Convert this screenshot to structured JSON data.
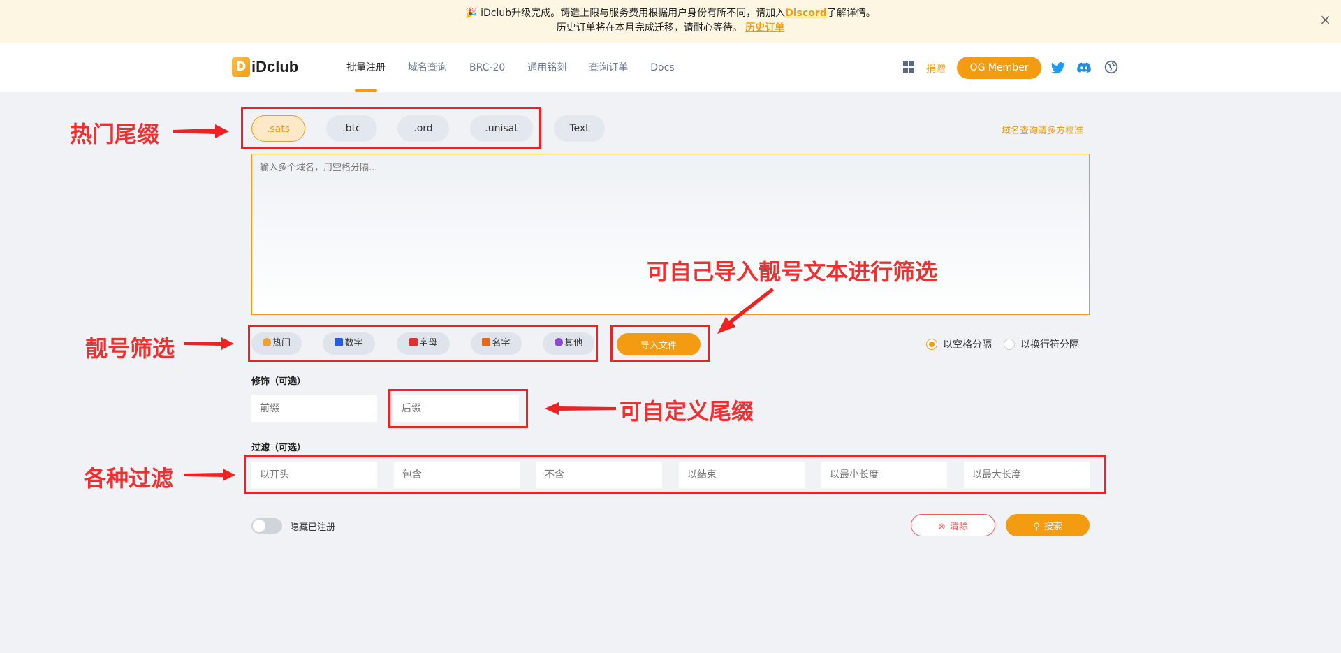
{
  "banner": {
    "line1_pre": "🎉 iDclub升级完成。铸造上限与服务费用根据用户身份有所不同，请加入",
    "line1_link": "Discord",
    "line1_post": "了解详情。",
    "line2_pre": "历史订单将在本月完成迁移，请耐心等待。",
    "line2_link": "历史订单",
    "close": "×"
  },
  "header": {
    "logo_mark": "D",
    "logo_text": "iDclub",
    "nav": [
      "批量注册",
      "域名查询",
      "BRC-20",
      "通用铭刻",
      "查询订单",
      "Docs"
    ],
    "donate": "捐赠",
    "og_member": "OG Member"
  },
  "annotations": {
    "hot_suffix": "热门尾缀",
    "import_text": "可自己导入靓号文本进行筛选",
    "nice_filter": "靓号筛选",
    "custom_suffix": "可自定义尾缀",
    "various_filter": "各种过滤"
  },
  "suffixes": [
    ".sats",
    ".btc",
    ".ord",
    ".unisat",
    "Text"
  ],
  "hint": "域名查询请多方校准",
  "textarea_placeholder": "输入多个域名，用空格分隔...",
  "filters": [
    {
      "label": "热门",
      "icon": "fire-icon",
      "color": "#f0a030"
    },
    {
      "label": "数字",
      "icon": "number-icon",
      "color": "#2a5bd7"
    },
    {
      "label": "字母",
      "icon": "letter-icon",
      "color": "#e03030"
    },
    {
      "label": "名字",
      "icon": "book-icon",
      "color": "#e06a20"
    },
    {
      "label": "其他",
      "icon": "person-icon",
      "color": "#8a4bd0"
    }
  ],
  "import_button": "导入文件",
  "separators": [
    {
      "label": "以空格分隔",
      "selected": true
    },
    {
      "label": "以换行符分隔",
      "selected": false
    }
  ],
  "decorate": {
    "title": "修饰（可选）",
    "prefix_placeholder": "前缀",
    "suffix_placeholder": "后缀"
  },
  "filter_section": {
    "title": "过滤（可选）",
    "fields": [
      "以开头",
      "包含",
      "不含",
      "以结束",
      "以最小长度",
      "以最大长度"
    ]
  },
  "hide_registered": "隐藏已注册",
  "clear_button": "清除",
  "search_button": "搜索",
  "colors": {
    "accent": "#f39c12",
    "annotation": "#ee2222"
  }
}
